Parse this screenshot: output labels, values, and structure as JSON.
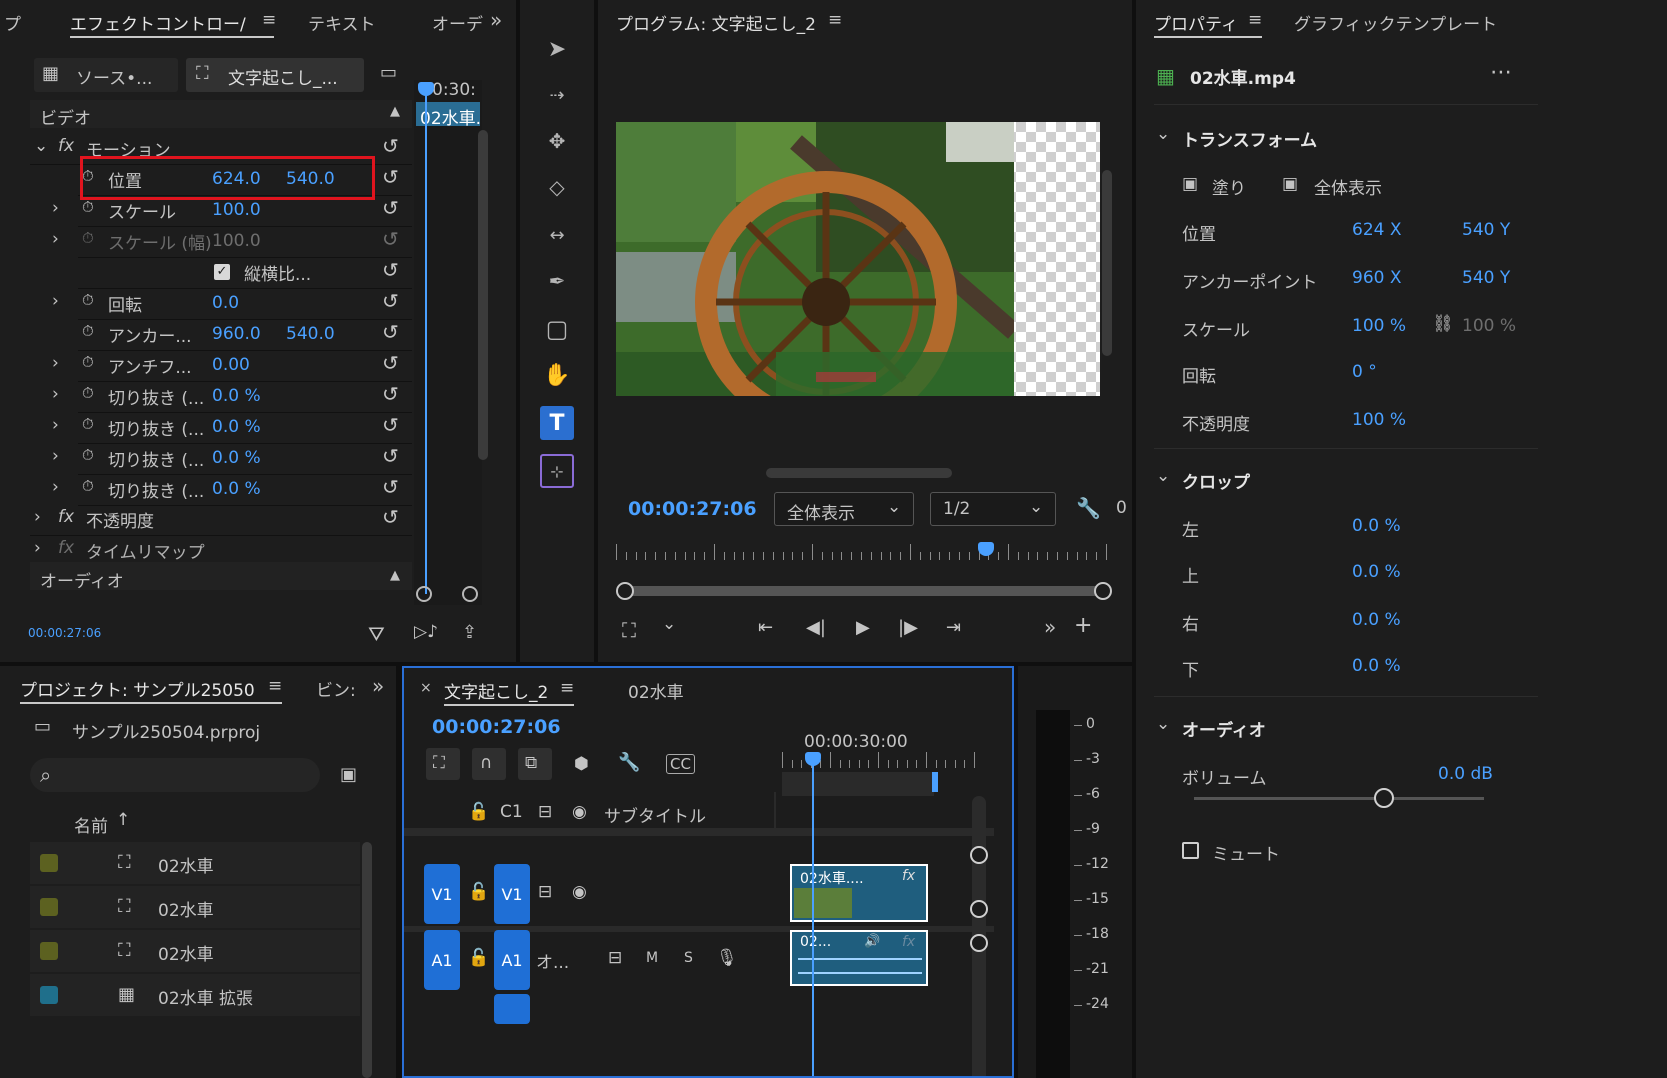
{
  "effect_controls": {
    "tab_prev": "プ",
    "tab_active": "エフェクトコントロー/",
    "tab_text": "テキスト",
    "tab_audio": "オーデ",
    "source_tab": "ソース•...",
    "sequence_tab": "文字起こし_...",
    "timecode_mini": "0:30:",
    "clip_label": "02水車.",
    "video_header": "ビデオ",
    "audio_header": "オーディオ",
    "timecode": "00:00:27:06",
    "rows": [
      {
        "label": "モーション"
      },
      {
        "label": "位置",
        "v1": "624.0",
        "v2": "540.0"
      },
      {
        "label": "スケール",
        "v1": "100.0"
      },
      {
        "label": "スケール (幅)",
        "v1": "100.0"
      },
      {
        "label": "縦横比..."
      },
      {
        "label": "回転",
        "v1": "0.0"
      },
      {
        "label": "アンカー...",
        "v1": "960.0",
        "v2": "540.0"
      },
      {
        "label": "アンチフ...",
        "v1": "0.00"
      },
      {
        "label": "切り抜き (...",
        "v1": "0.0 %"
      },
      {
        "label": "切り抜き (...",
        "v1": "0.0 %"
      },
      {
        "label": "切り抜き (...",
        "v1": "0.0 %"
      },
      {
        "label": "切り抜き (...",
        "v1": "0.0 %"
      },
      {
        "label": "不透明度"
      },
      {
        "label": "タイムリマップ"
      }
    ]
  },
  "program": {
    "title": "プログラム: 文字起こし_2",
    "timecode": "00:00:27:06",
    "zoom": "全体表示",
    "resolution": "1/2",
    "extra": "0"
  },
  "properties": {
    "tab_active": "プロパティ",
    "tab_graphic": "グラフィックテンプレート",
    "file": "02水車.mp4",
    "transform_header": "トランスフォーム",
    "fill_label": "塗り",
    "fit_label": "全体表示",
    "position_label": "位置",
    "position_x": "624 X",
    "position_y": "540 Y",
    "anchor_label": "アンカーポイント",
    "anchor_x": "960 X",
    "anchor_y": "540 Y",
    "scale_label": "スケール",
    "scale_value": "100 %",
    "scale_w_value": "100 %",
    "rotation_label": "回転",
    "rotation_value": "0 °",
    "opacity_label": "不透明度",
    "opacity_value": "100 %",
    "crop_header": "クロップ",
    "crop_left": "左",
    "crop_top": "上",
    "crop_right": "右",
    "crop_bottom": "下",
    "crop_value": "0.0 %",
    "audio_header": "オーディオ",
    "volume_label": "ボリューム",
    "volume_value": "0.0 dB",
    "mute_label": "ミュート"
  },
  "project": {
    "title": "プロジェクト: サンプル25050",
    "tab_bin": "ビン:",
    "file": "サンプル250504.prproj",
    "name_col": "名前",
    "items": [
      {
        "name": "02水車",
        "color": "#5c6120"
      },
      {
        "name": "02水車",
        "color": "#5c6120"
      },
      {
        "name": "02水車",
        "color": "#5c6120"
      },
      {
        "name": "02水車 拡張",
        "color": "#1f6f8b"
      }
    ]
  },
  "timeline": {
    "seq_tab": "文字起こし_2",
    "clip_tab": "02水車",
    "timecode": "00:00:27:06",
    "ruler_time": "00:00:30:00",
    "c1": "C1",
    "subtitle": "サブタイトル",
    "v1": "V1",
    "a1": "A1",
    "a1_name": "オ...",
    "m": "M",
    "s": "S",
    "video_clip": "02水車....",
    "audio_clip": "02...",
    "fx": "fx"
  },
  "meter": {
    "labels": [
      "0",
      "-3",
      "-6",
      "-9",
      "-12",
      "-15",
      "-18",
      "-21",
      "-24"
    ]
  },
  "colors": {
    "accent": "#4aa0ff",
    "highlight": "#e0141e",
    "track": "#1f6fd6"
  }
}
